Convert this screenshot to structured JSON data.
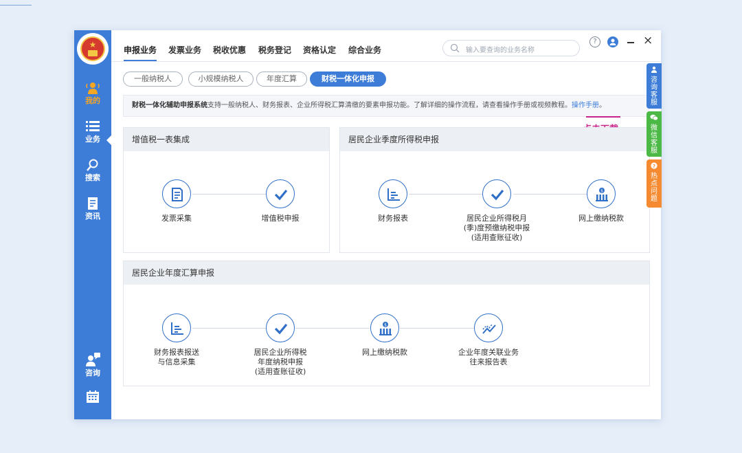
{
  "sidebar": {
    "items": [
      {
        "label": "我的",
        "icon": "user-signal-icon"
      },
      {
        "label": "业务",
        "icon": "list-icon"
      },
      {
        "label": "搜索",
        "icon": "search-icon"
      },
      {
        "label": "资讯",
        "icon": "document-icon"
      },
      {
        "label": "咨询",
        "icon": "chat-user-icon"
      },
      {
        "label": "",
        "icon": "calendar-icon"
      }
    ]
  },
  "header": {
    "menu": [
      "申报业务",
      "发票业务",
      "税收优惠",
      "税务登记",
      "资格认定",
      "综合业务"
    ],
    "search_placeholder": "输入要查询的业务名称",
    "help_label": "?"
  },
  "pills": [
    "一般纳税人",
    "小规模纳税人",
    "年度汇算",
    "财税一体化申报"
  ],
  "info": {
    "bold": "财税一体化辅助申报系统",
    "text": "支持一般纳税人、财务报表、企业所得税汇算清缴的要素申报功能。了解详细的操作流程，请查看操作手册或视频教程。",
    "link": "操作手册",
    "tail": "。",
    "annotation": "点击下载"
  },
  "cards": {
    "vat": {
      "title": "增值税一表集成",
      "steps": [
        "发票采集",
        "增值税申报"
      ]
    },
    "quarterly": {
      "title": "居民企业季度所得税申报",
      "steps": [
        "财务报表",
        "居民企业所得税月\n(季)度预缴纳税申报\n(适用查账征收)",
        "网上缴纳税款"
      ]
    },
    "annual": {
      "title": "居民企业年度汇算申报",
      "steps": [
        "财务报表报送\n与信息采集",
        "居民企业所得税\n年度纳税申报\n(适用查账征收)",
        "网上缴纳税款",
        "企业年度关联业务\n往来报告表"
      ]
    }
  },
  "side_tabs": [
    "咨询客服",
    "微信客服",
    "热点问题"
  ],
  "colors": {
    "primary": "#3d7dd8",
    "annotation": "#c8238a",
    "green": "#4cb845",
    "orange": "#f58a31"
  }
}
